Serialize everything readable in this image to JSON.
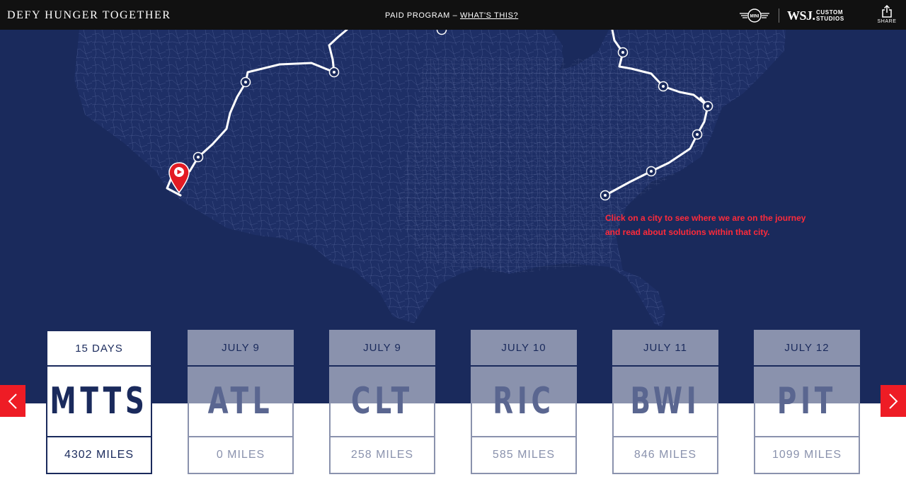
{
  "header": {
    "brand": "DEFY HUNGER TOGETHER",
    "paid_label": "PAID PROGRAM – ",
    "whats_this": "WHAT'S THIS?",
    "partner_logo": "MINI",
    "publisher_logo": "WSJ.",
    "publisher_sub_1": "CUSTOM",
    "publisher_sub_2": "STUDIOS",
    "share_label": "SHARE"
  },
  "map": {
    "hint_line1": "Click on a city to see where we are on the journey",
    "hint_line2": "and read about solutions within that city.",
    "background_color": "#1a2a5c",
    "route_color": "#ffffff",
    "marker_color": "#e31b23"
  },
  "cards": [
    {
      "date": "15 DAYS",
      "code": "MTTS",
      "miles": "4302 MILES",
      "active": true
    },
    {
      "date": "JULY 9",
      "code": "ATL",
      "miles": "0 MILES",
      "active": false
    },
    {
      "date": "JULY 9",
      "code": "CLT",
      "miles": "258 MILES",
      "active": false
    },
    {
      "date": "JULY 10",
      "code": "RIC",
      "miles": "585 MILES",
      "active": false
    },
    {
      "date": "JULY 11",
      "code": "BWI",
      "miles": "846 MILES",
      "active": false
    },
    {
      "date": "JULY 12",
      "code": "PIT",
      "miles": "1099 MILES",
      "active": false
    }
  ],
  "nav": {
    "prev_icon": "chevron-left-icon",
    "next_icon": "chevron-right-icon",
    "accent": "#ee1c25"
  }
}
